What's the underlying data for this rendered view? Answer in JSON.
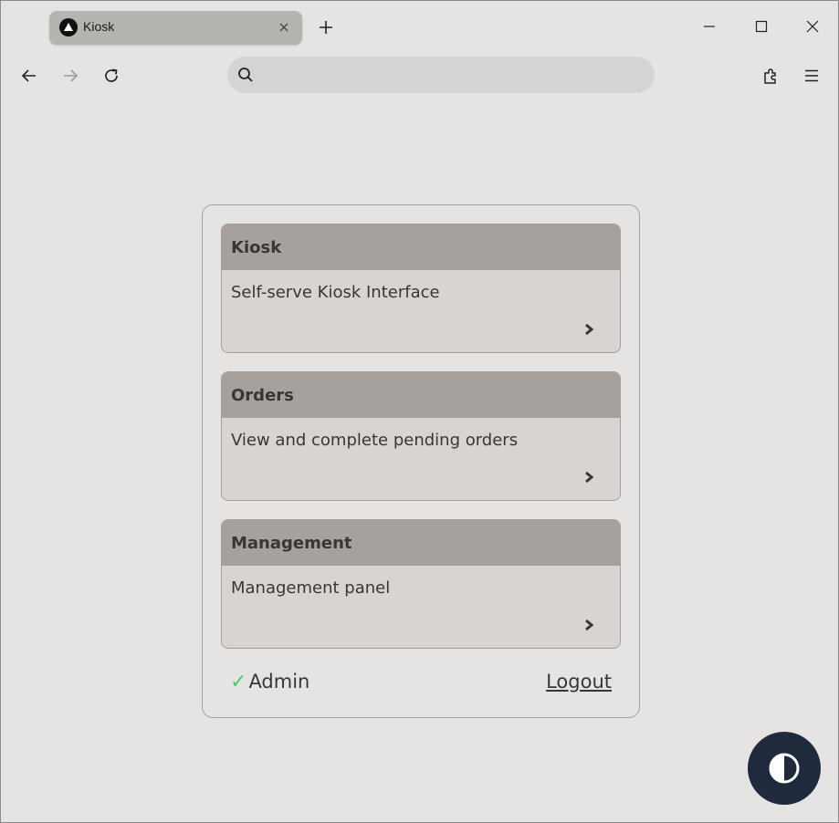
{
  "browser": {
    "tab_title": "Kiosk",
    "address_value": "",
    "address_placeholder": ""
  },
  "cards": [
    {
      "title": "Kiosk",
      "description": "Self-serve Kiosk Interface"
    },
    {
      "title": "Orders",
      "description": "View and complete pending orders"
    },
    {
      "title": "Management",
      "description": "Management panel"
    }
  ],
  "footer": {
    "check_symbol": "✓",
    "user_label": "Admin",
    "logout_label": "Logout"
  },
  "colors": {
    "page_bg": "#e5e4e2",
    "card_header_bg": "#a7a19d",
    "card_body_bg": "#d8d4d1",
    "check_color": "#3bd66b",
    "theme_button_bg": "#1f2a3c"
  },
  "icons": [
    "app-favicon-icon",
    "close-icon",
    "plus-icon",
    "minimize-icon",
    "maximize-icon",
    "window-close-icon",
    "back-arrow-icon",
    "forward-arrow-icon",
    "reload-icon",
    "search-icon",
    "extensions-icon",
    "menu-icon",
    "chevron-right-icon",
    "contrast-icon"
  ]
}
